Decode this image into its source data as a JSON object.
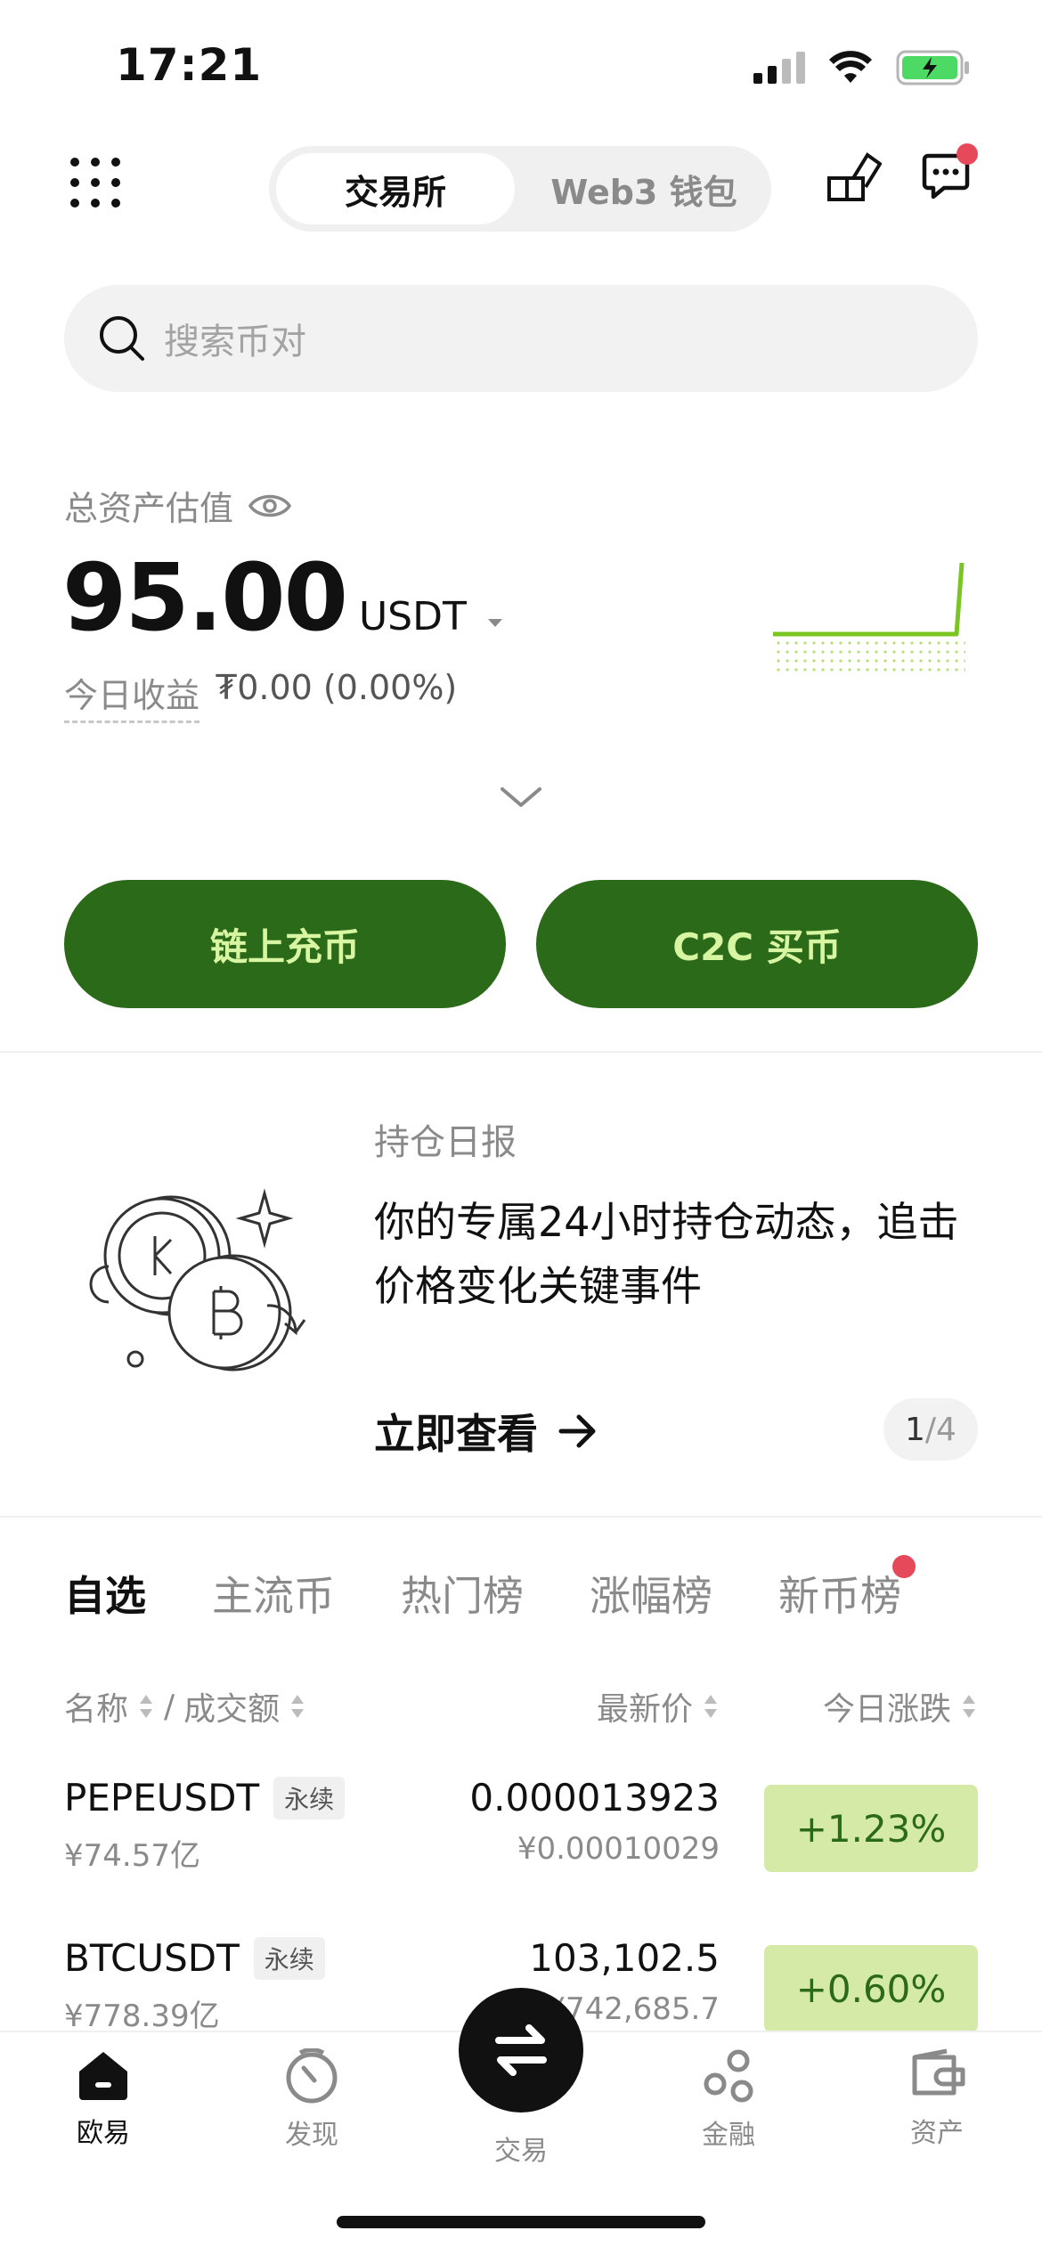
{
  "status": {
    "time": "17:21"
  },
  "nav": {
    "tab_exchange": "交易所",
    "tab_web3": "Web3 钱包"
  },
  "search": {
    "placeholder": "搜索币对"
  },
  "assets": {
    "label": "总资产估值",
    "amount": "95.00",
    "currency": "USDT",
    "pnl_label": "今日收益",
    "pnl_value": "₮0.00 (0.00%)"
  },
  "actions": {
    "deposit": "链上充币",
    "c2c": "C2C 买币"
  },
  "banner": {
    "subtitle": "持仓日报",
    "title": "你的专属24小时持仓动态，追击价格变化关键事件",
    "cta": "立即查看",
    "page": "1",
    "total": "/4"
  },
  "market": {
    "tabs": [
      "自选",
      "主流币",
      "热门榜",
      "涨幅榜",
      "新币榜"
    ],
    "headers": {
      "name": "名称",
      "sep": "/",
      "volume": "成交额",
      "price": "最新价",
      "change": "今日涨跌"
    },
    "rows": [
      {
        "symbol": "PEPEUSDT",
        "tag": "永续",
        "volume": "¥74.57亿",
        "price": "0.000013923",
        "cny": "¥0.00010029",
        "change": "+1.23%"
      },
      {
        "symbol": "BTCUSDT",
        "tag": "永续",
        "volume": "¥778.39亿",
        "price": "103,102.5",
        "cny": "¥742,685.7",
        "change": "+0.60%"
      }
    ]
  },
  "bottom_nav": {
    "home": "欧易",
    "discover": "发现",
    "trade": "交易",
    "finance": "金融",
    "assets": "资产"
  },
  "colors": {
    "accent": "#2a6a18",
    "accent_text": "#d8f5a2",
    "chg_bg": "#d6eaa8",
    "badge": "#e64a5a"
  }
}
